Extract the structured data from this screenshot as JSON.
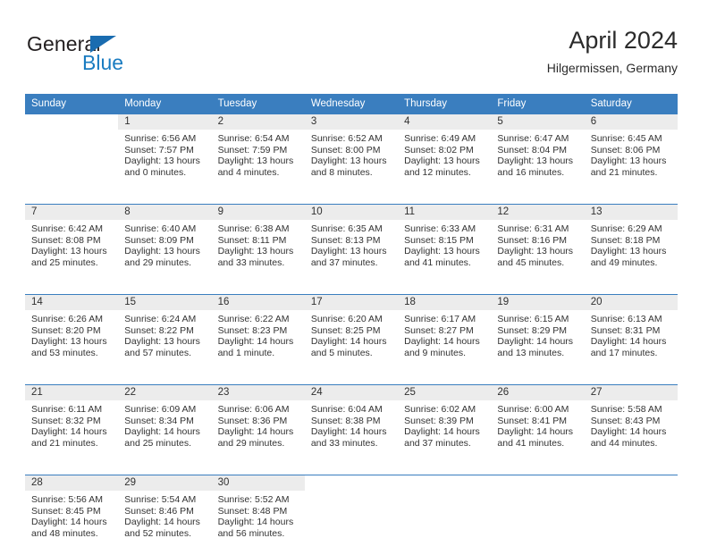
{
  "brand": {
    "name_part1": "General",
    "name_part2": "Blue",
    "color_dark": "#231f20",
    "color_blue": "#1a7cc1",
    "triangle_icon": "blue-triangle-icon"
  },
  "header": {
    "title": "April 2024",
    "subtitle": "Hilgermissen, Germany"
  },
  "theme": {
    "header_blue": "#3a7ebf",
    "daynumber_band": "#ececec",
    "text": "#333333"
  },
  "weekdays": [
    "Sunday",
    "Monday",
    "Tuesday",
    "Wednesday",
    "Thursday",
    "Friday",
    "Saturday"
  ],
  "weeks": [
    [
      {
        "day": "",
        "lines": []
      },
      {
        "day": "1",
        "lines": [
          "Sunrise: 6:56 AM",
          "Sunset: 7:57 PM",
          "Daylight: 13 hours",
          "and 0 minutes."
        ]
      },
      {
        "day": "2",
        "lines": [
          "Sunrise: 6:54 AM",
          "Sunset: 7:59 PM",
          "Daylight: 13 hours",
          "and 4 minutes."
        ]
      },
      {
        "day": "3",
        "lines": [
          "Sunrise: 6:52 AM",
          "Sunset: 8:00 PM",
          "Daylight: 13 hours",
          "and 8 minutes."
        ]
      },
      {
        "day": "4",
        "lines": [
          "Sunrise: 6:49 AM",
          "Sunset: 8:02 PM",
          "Daylight: 13 hours",
          "and 12 minutes."
        ]
      },
      {
        "day": "5",
        "lines": [
          "Sunrise: 6:47 AM",
          "Sunset: 8:04 PM",
          "Daylight: 13 hours",
          "and 16 minutes."
        ]
      },
      {
        "day": "6",
        "lines": [
          "Sunrise: 6:45 AM",
          "Sunset: 8:06 PM",
          "Daylight: 13 hours",
          "and 21 minutes."
        ]
      }
    ],
    [
      {
        "day": "7",
        "lines": [
          "Sunrise: 6:42 AM",
          "Sunset: 8:08 PM",
          "Daylight: 13 hours",
          "and 25 minutes."
        ]
      },
      {
        "day": "8",
        "lines": [
          "Sunrise: 6:40 AM",
          "Sunset: 8:09 PM",
          "Daylight: 13 hours",
          "and 29 minutes."
        ]
      },
      {
        "day": "9",
        "lines": [
          "Sunrise: 6:38 AM",
          "Sunset: 8:11 PM",
          "Daylight: 13 hours",
          "and 33 minutes."
        ]
      },
      {
        "day": "10",
        "lines": [
          "Sunrise: 6:35 AM",
          "Sunset: 8:13 PM",
          "Daylight: 13 hours",
          "and 37 minutes."
        ]
      },
      {
        "day": "11",
        "lines": [
          "Sunrise: 6:33 AM",
          "Sunset: 8:15 PM",
          "Daylight: 13 hours",
          "and 41 minutes."
        ]
      },
      {
        "day": "12",
        "lines": [
          "Sunrise: 6:31 AM",
          "Sunset: 8:16 PM",
          "Daylight: 13 hours",
          "and 45 minutes."
        ]
      },
      {
        "day": "13",
        "lines": [
          "Sunrise: 6:29 AM",
          "Sunset: 8:18 PM",
          "Daylight: 13 hours",
          "and 49 minutes."
        ]
      }
    ],
    [
      {
        "day": "14",
        "lines": [
          "Sunrise: 6:26 AM",
          "Sunset: 8:20 PM",
          "Daylight: 13 hours",
          "and 53 minutes."
        ]
      },
      {
        "day": "15",
        "lines": [
          "Sunrise: 6:24 AM",
          "Sunset: 8:22 PM",
          "Daylight: 13 hours",
          "and 57 minutes."
        ]
      },
      {
        "day": "16",
        "lines": [
          "Sunrise: 6:22 AM",
          "Sunset: 8:23 PM",
          "Daylight: 14 hours",
          "and 1 minute."
        ]
      },
      {
        "day": "17",
        "lines": [
          "Sunrise: 6:20 AM",
          "Sunset: 8:25 PM",
          "Daylight: 14 hours",
          "and 5 minutes."
        ]
      },
      {
        "day": "18",
        "lines": [
          "Sunrise: 6:17 AM",
          "Sunset: 8:27 PM",
          "Daylight: 14 hours",
          "and 9 minutes."
        ]
      },
      {
        "day": "19",
        "lines": [
          "Sunrise: 6:15 AM",
          "Sunset: 8:29 PM",
          "Daylight: 14 hours",
          "and 13 minutes."
        ]
      },
      {
        "day": "20",
        "lines": [
          "Sunrise: 6:13 AM",
          "Sunset: 8:31 PM",
          "Daylight: 14 hours",
          "and 17 minutes."
        ]
      }
    ],
    [
      {
        "day": "21",
        "lines": [
          "Sunrise: 6:11 AM",
          "Sunset: 8:32 PM",
          "Daylight: 14 hours",
          "and 21 minutes."
        ]
      },
      {
        "day": "22",
        "lines": [
          "Sunrise: 6:09 AM",
          "Sunset: 8:34 PM",
          "Daylight: 14 hours",
          "and 25 minutes."
        ]
      },
      {
        "day": "23",
        "lines": [
          "Sunrise: 6:06 AM",
          "Sunset: 8:36 PM",
          "Daylight: 14 hours",
          "and 29 minutes."
        ]
      },
      {
        "day": "24",
        "lines": [
          "Sunrise: 6:04 AM",
          "Sunset: 8:38 PM",
          "Daylight: 14 hours",
          "and 33 minutes."
        ]
      },
      {
        "day": "25",
        "lines": [
          "Sunrise: 6:02 AM",
          "Sunset: 8:39 PM",
          "Daylight: 14 hours",
          "and 37 minutes."
        ]
      },
      {
        "day": "26",
        "lines": [
          "Sunrise: 6:00 AM",
          "Sunset: 8:41 PM",
          "Daylight: 14 hours",
          "and 41 minutes."
        ]
      },
      {
        "day": "27",
        "lines": [
          "Sunrise: 5:58 AM",
          "Sunset: 8:43 PM",
          "Daylight: 14 hours",
          "and 44 minutes."
        ]
      }
    ],
    [
      {
        "day": "28",
        "lines": [
          "Sunrise: 5:56 AM",
          "Sunset: 8:45 PM",
          "Daylight: 14 hours",
          "and 48 minutes."
        ]
      },
      {
        "day": "29",
        "lines": [
          "Sunrise: 5:54 AM",
          "Sunset: 8:46 PM",
          "Daylight: 14 hours",
          "and 52 minutes."
        ]
      },
      {
        "day": "30",
        "lines": [
          "Sunrise: 5:52 AM",
          "Sunset: 8:48 PM",
          "Daylight: 14 hours",
          "and 56 minutes."
        ]
      },
      {
        "day": "",
        "lines": []
      },
      {
        "day": "",
        "lines": []
      },
      {
        "day": "",
        "lines": []
      },
      {
        "day": "",
        "lines": []
      }
    ]
  ]
}
